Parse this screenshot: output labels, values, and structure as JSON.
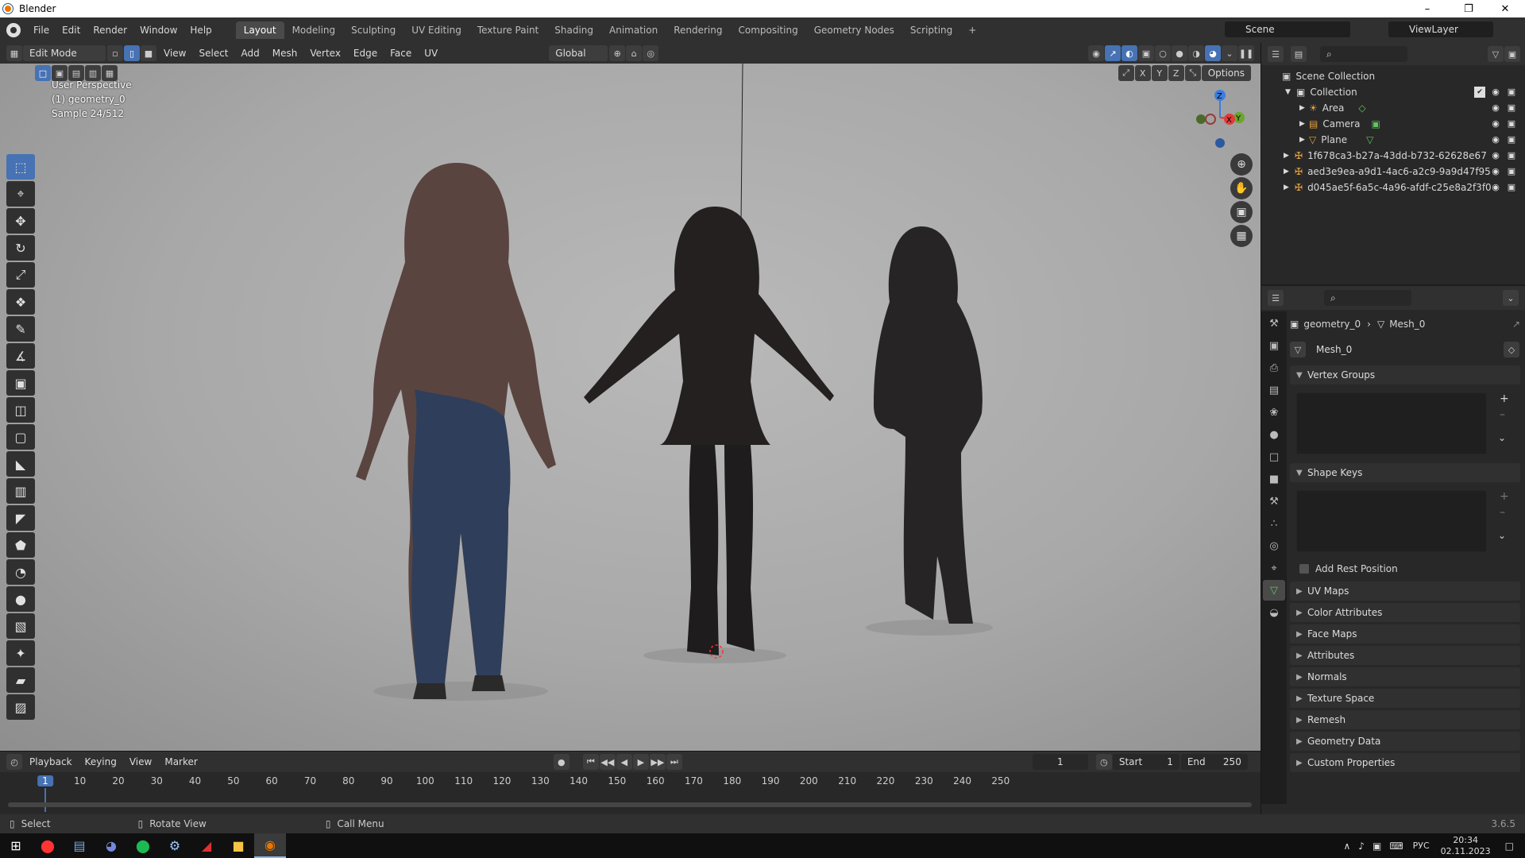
{
  "window": {
    "title": "Blender"
  },
  "menu": [
    "File",
    "Edit",
    "Render",
    "Window",
    "Help"
  ],
  "workspaces": [
    "Layout",
    "Modeling",
    "Sculpting",
    "UV Editing",
    "Texture Paint",
    "Shading",
    "Animation",
    "Rendering",
    "Compositing",
    "Geometry Nodes",
    "Scripting"
  ],
  "scene": {
    "name": "Scene",
    "view_layer": "ViewLayer"
  },
  "header": {
    "mode": "Edit Mode",
    "menus": [
      "View",
      "Select",
      "Add",
      "Mesh",
      "Vertex",
      "Edge",
      "Face",
      "UV"
    ],
    "orientation": "Global",
    "axis_x": "X",
    "axis_y": "Y",
    "axis_z": "Z",
    "options": "Options"
  },
  "viewport": {
    "line1": "User Perspective",
    "line2": "(1) geometry_0",
    "line3": "Sample 24/512"
  },
  "gizmo": {
    "z": "Z",
    "y": "Y",
    "x": "X"
  },
  "outliner": {
    "root": "Scene Collection",
    "items": [
      {
        "label": "Collection"
      },
      {
        "label": "Area"
      },
      {
        "label": "Camera"
      },
      {
        "label": "Plane"
      },
      {
        "label": "1f678ca3-b27a-43dd-b732-62628e67"
      },
      {
        "label": "aed3e9ea-a9d1-4ac6-a2c9-9a9d47f95"
      },
      {
        "label": "d045ae5f-6a5c-4a96-afdf-c25e8a2f3f0"
      }
    ]
  },
  "properties": {
    "breadcrumb_object": "geometry_0",
    "breadcrumb_mesh": "Mesh_0",
    "mesh_name": "Mesh_0",
    "vertex_groups": "Vertex Groups",
    "shape_keys": "Shape Keys",
    "add_rest_position": "Add Rest Position",
    "sections": [
      "UV Maps",
      "Color Attributes",
      "Face Maps",
      "Attributes",
      "Normals",
      "Texture Space",
      "Remesh",
      "Geometry Data",
      "Custom Properties"
    ]
  },
  "timeline": {
    "menus": [
      "Playback",
      "Keying",
      "View",
      "Marker"
    ],
    "current_frame": "1",
    "start_label": "Start",
    "start": "1",
    "end_label": "End",
    "end": "250",
    "ticks": [
      "1",
      "10",
      "20",
      "30",
      "40",
      "50",
      "60",
      "70",
      "80",
      "90",
      "100",
      "110",
      "120",
      "130",
      "140",
      "150",
      "160",
      "170",
      "180",
      "190",
      "200",
      "210",
      "220",
      "230",
      "240",
      "250"
    ]
  },
  "statusbar": {
    "select": "Select",
    "rotate": "Rotate View",
    "call_menu": "Call Menu",
    "version": "3.6.5"
  },
  "taskbar": {
    "lang": "РУС",
    "time": "20:34",
    "date": "02.11.2023"
  },
  "colors": {
    "accent": "#4772b3",
    "outliner_mesh": "#5fc55f",
    "blender_orange": "#ea7600"
  }
}
